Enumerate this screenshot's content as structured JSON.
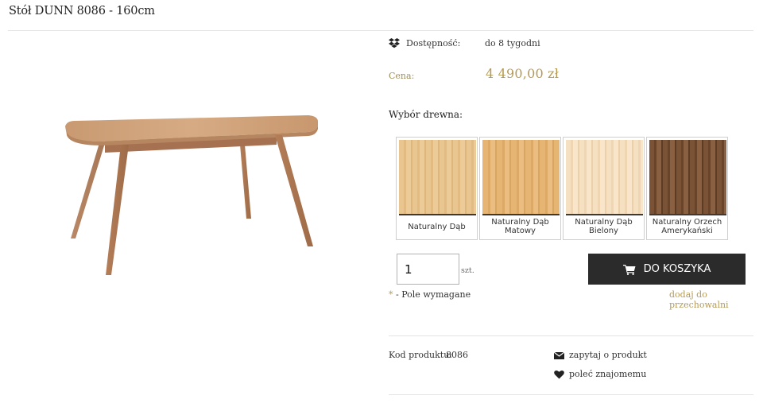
{
  "product": {
    "title": "Stół DUNN 8086 - 160cm",
    "availability_label": "Dostępność:",
    "availability_value": "do 8 tygodni",
    "price_label": "Cena:",
    "price_value": "4 490,00 zł",
    "code_label": "Kod produktu:",
    "code_value": "8086"
  },
  "wood": {
    "heading": "Wybór drewna:",
    "options": [
      {
        "label": "Naturalny Dąb",
        "icon": "oak-natural-swatch"
      },
      {
        "label": "Naturalny Dąb Matowy",
        "icon": "oak-matte-swatch"
      },
      {
        "label": "Naturalny Dąb Bielony",
        "icon": "oak-bleached-swatch"
      },
      {
        "label": "Naturalny Orzech Amerykański",
        "icon": "walnut-swatch"
      }
    ]
  },
  "cart": {
    "quantity": "1",
    "unit": "szt.",
    "button_label": "DO KOSZYKA",
    "required_star": "*",
    "required_text": " - Pole wymagane",
    "wishlist_label": "dodaj do przechowalni"
  },
  "links": {
    "ask_label": "zapytaj o produkt",
    "recommend_label": "poleć znajomemu"
  },
  "icons": {
    "availability": "dropbox-box-icon",
    "cart": "cart-icon",
    "ask": "envelope-icon",
    "recommend": "heart-icon"
  },
  "colors": {
    "accent_gold": "#b59a55",
    "button_dark": "#2b2b2b"
  }
}
